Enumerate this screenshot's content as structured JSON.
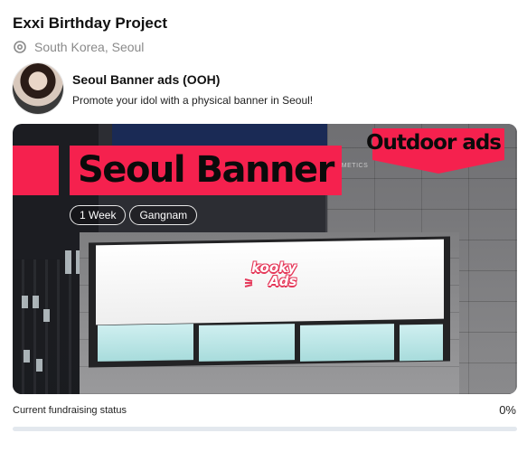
{
  "header": {
    "title": "Exxi Birthday Project",
    "location": "South Korea, Seoul",
    "location_icon": "location-pin-icon"
  },
  "ad": {
    "title": "Seoul Banner ads (OOH)",
    "description": "Promote your idol with a physical banner in Seoul!"
  },
  "banner": {
    "headline": "Seoul Banner",
    "badge": "Outdoor ads",
    "tags": [
      "1 Week",
      "Gangnam"
    ],
    "building_sign": "PHILOS COSMETICS",
    "logo_line1": "kooky",
    "logo_line2": "Ads",
    "accent_color": "#f5214e"
  },
  "fundraising": {
    "label": "Current fundraising status",
    "percent_text": "0%",
    "progress_fraction": 0
  }
}
